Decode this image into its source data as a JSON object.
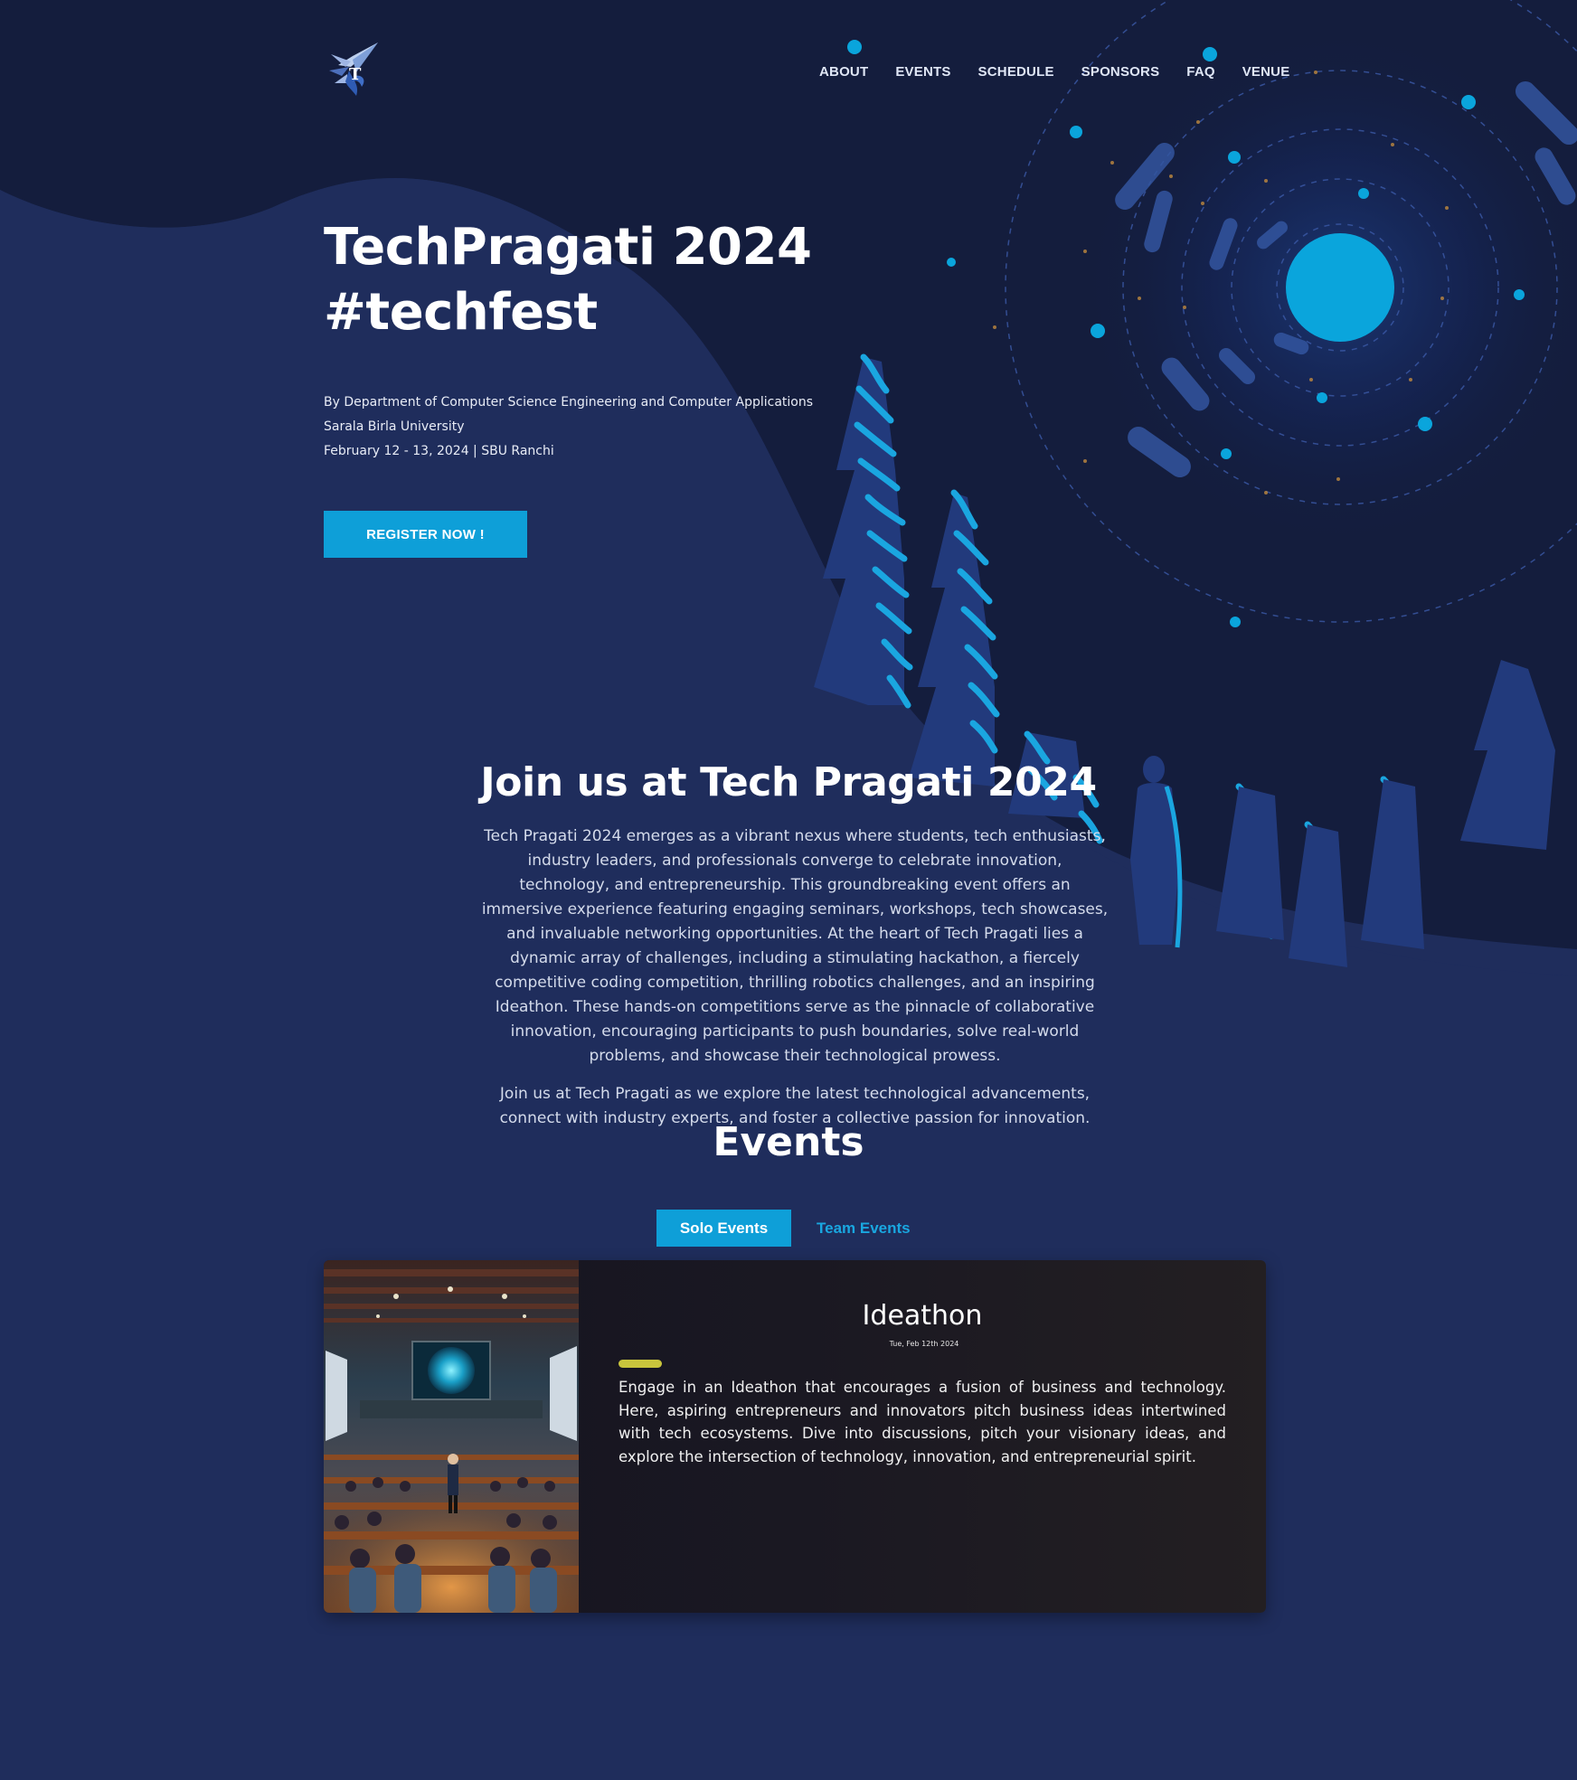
{
  "nav": {
    "items": [
      {
        "label": "ABOUT"
      },
      {
        "label": "EVENTS"
      },
      {
        "label": "SCHEDULE"
      },
      {
        "label": "SPONSORS"
      },
      {
        "label": "FAQ"
      },
      {
        "label": "VENUE"
      }
    ]
  },
  "hero": {
    "title_line1": "TechPragati 2024",
    "title_line2": "#techfest",
    "organizer": "By Department of Computer Science Engineering and Computer Applications",
    "university": "Sarala Birla University",
    "dates": "February 12 - 13, 2024 | SBU Ranchi",
    "register_label": "REGISTER NOW !"
  },
  "about": {
    "title": "Join us at Tech Pragati 2024",
    "paragraph1": "Tech Pragati 2024 emerges as a vibrant nexus where students, tech enthusiasts, industry leaders, and professionals converge to celebrate innovation, technology, and entrepreneurship. This groundbreaking event offers an immersive experience featuring engaging seminars, workshops, tech showcases, and invaluable networking opportunities. At the heart of Tech Pragati lies a dynamic array of challenges, including a stimulating hackathon, a fiercely competitive coding competition, thrilling robotics challenges, and an inspiring Ideathon. These hands-on competitions serve as the pinnacle of collaborative innovation, encouraging participants to push boundaries, solve real-world problems, and showcase their technological prowess.",
    "paragraph2": "Join us at Tech Pragati as we explore the latest technological advancements, connect with industry experts, and foster a collective passion for innovation."
  },
  "events": {
    "title": "Events",
    "tabs": [
      {
        "label": "Solo Events",
        "active": true
      },
      {
        "label": "Team Events",
        "active": false
      }
    ],
    "card": {
      "name": "Ideathon",
      "date": "Tue, Feb 12th 2024",
      "description": "Engage in an Ideathon that encourages a fusion of business and technology. Here, aspiring entrepreneurs and innovators pitch business ideas intertwined with tech ecosystems. Dive into discussions, pitch your visionary ideas, and explore the intersection of technology, innovation, and entrepreneurial spirit."
    }
  },
  "colors": {
    "page_bg": "#1f2d5c",
    "hero_dark": "#141d3d",
    "accent": "#0e9fd8",
    "tree_blue": "#1aa6e0",
    "card_accent": "#c9c53c"
  },
  "icons": {
    "logo": "techpragati-rocket-logo"
  }
}
